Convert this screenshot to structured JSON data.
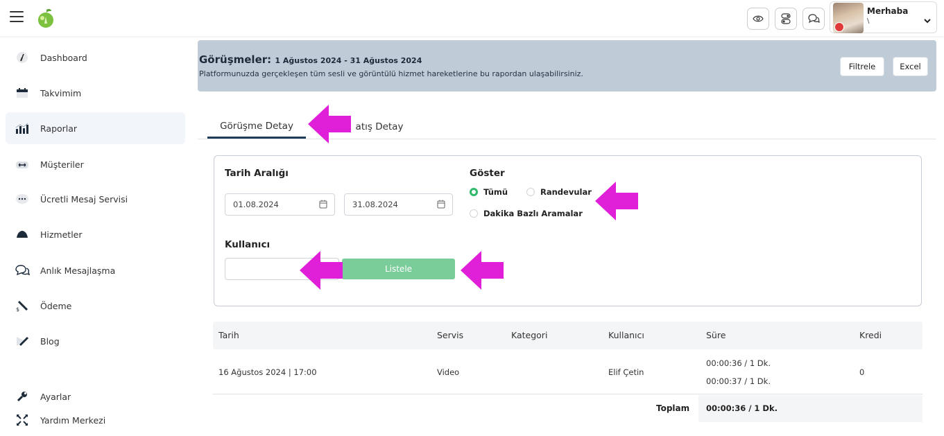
{
  "header": {
    "user_greeting": "Merhaba",
    "user_sub": "\\"
  },
  "sidebar": {
    "items": [
      {
        "label": "Dashboard",
        "icon": "dashboard-gauge-icon"
      },
      {
        "label": "Takvimim",
        "icon": "calendar-icon"
      },
      {
        "label": "Raporlar",
        "icon": "bar-chart-icon",
        "active": true
      },
      {
        "label": "Müşteriler",
        "icon": "users-icon"
      },
      {
        "label": "Ücretli Mesaj Servisi",
        "icon": "chat-dots-icon"
      },
      {
        "label": "Hizmetler",
        "icon": "services-icon"
      },
      {
        "label": "Anlık Mesajlaşma",
        "icon": "chat-bubbles-icon"
      },
      {
        "label": "Ödeme",
        "icon": "payment-icon"
      },
      {
        "label": "Blog",
        "icon": "pencil-icon"
      },
      {
        "label": "Ayarlar",
        "icon": "wrench-icon"
      },
      {
        "label": "Yardım Merkezi",
        "icon": "help-arrows-icon"
      }
    ]
  },
  "banner": {
    "title": "Görüşmeler:",
    "date_range": "1 Ağustos 2024 - 31 Ağustos 2024",
    "description": "Platformunuzda gerçekleşen tüm sesli ve görüntülü hizmet hareketlerine bu rapordan ulaşabilirsiniz.",
    "filter_button": "Filtrele",
    "excel_button": "Excel"
  },
  "tabs": [
    {
      "label": "Görüşme Detay",
      "active": true
    },
    {
      "label": "Satış Detay",
      "visible_fragment": "atış Detay"
    }
  ],
  "filters": {
    "date_range_label": "Tarih Aralığı",
    "start_date": "01.08.2024",
    "end_date": "31.08.2024",
    "show_label": "Göster",
    "radio_all": "Tümü",
    "radio_appointments": "Randevular",
    "radio_minute_calls": "Dakika Bazlı Aramalar",
    "selected": "Tümü",
    "user_label": "Kullanıcı",
    "user_value": "",
    "list_button": "Listele"
  },
  "table": {
    "columns": [
      "Tarih",
      "Servis",
      "Kategori",
      "Kullanıcı",
      "Süre",
      "Kredi"
    ],
    "rows": [
      {
        "tarih": "16 Ağustos 2024 | 17:00",
        "servis": "Video",
        "kategori": "",
        "kullanici": "Elif Çetin",
        "sure_1": "00:00:36 / 1 Dk.",
        "sure_2": "00:00:37 / 1 Dk.",
        "kredi": "0"
      }
    ],
    "total_label": "Toplam",
    "total_value": "00:00:36 / 1 Dk."
  },
  "colors": {
    "accent_green": "#7acc99",
    "banner_bg": "#bfccd8",
    "annotation_arrow": "#e020d8",
    "tab_underline": "#1d3b5a"
  }
}
